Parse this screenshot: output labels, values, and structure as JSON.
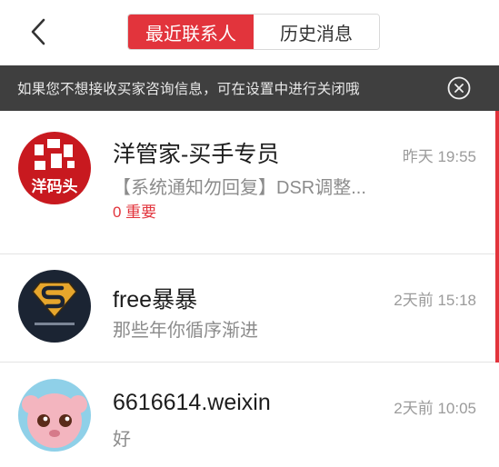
{
  "header": {
    "back_icon": "chevron-left-icon",
    "tabs": [
      {
        "label": "最近联系人",
        "active": true
      },
      {
        "label": "历史消息",
        "active": false
      }
    ]
  },
  "notice": {
    "text": "如果您不想接收买家咨询信息，可在设置中进行关闭哦",
    "close_icon": "close-circle-icon"
  },
  "conversations": [
    {
      "name": "洋管家-买手专员",
      "time": "昨天 19:55",
      "preview": "【系统通知勿回复】DSR调整...",
      "tag": "0 重要",
      "avatar_text": "洋码头",
      "avatar_color": "#c8191f",
      "unread_marker": true
    },
    {
      "name": "free暴暴",
      "time": "2天前 15:18",
      "preview": "那些年你循序渐进",
      "avatar_color": "#1b2433",
      "unread_marker": true
    },
    {
      "name": "6616614.weixin",
      "time": "2天前 10:05",
      "preview": "好",
      "avatar_color": "#8fd0e8",
      "unread_marker": false
    }
  ],
  "colors": {
    "accent": "#e2343c",
    "notice_bg": "#3f3f3f"
  }
}
